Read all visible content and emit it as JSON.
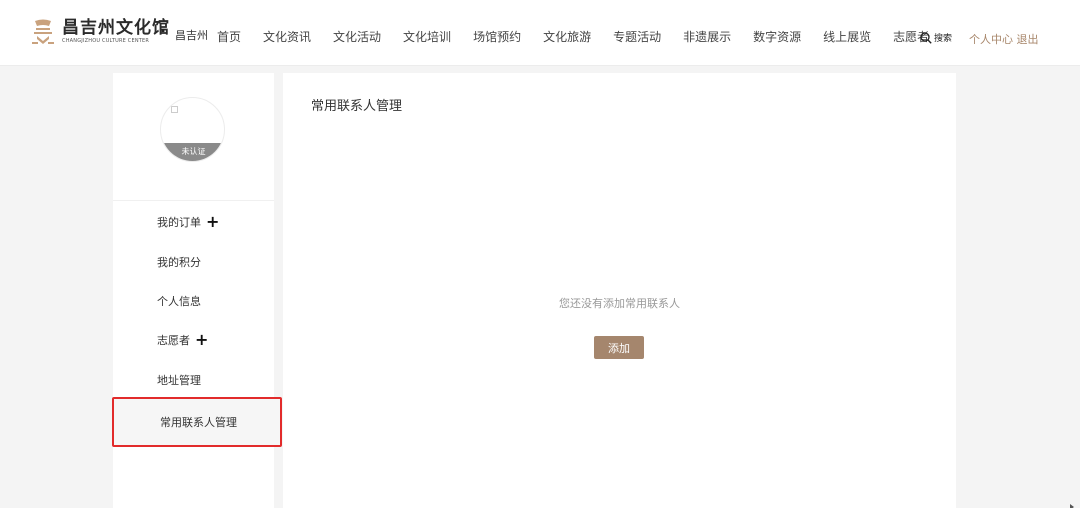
{
  "header": {
    "logo_cn": "昌吉州文化馆",
    "logo_en": "CHANGJIZHOU CULTURE CENTER",
    "logo_dot": ".",
    "city": "昌吉州",
    "nav": [
      "首页",
      "文化资讯",
      "文化活动",
      "文化培训",
      "场馆预约",
      "文化旅游",
      "专题活动",
      "非遗展示",
      "数字资源",
      "线上展览",
      "志愿者"
    ],
    "search_label": "搜索",
    "user_center": "个人中心",
    "logout": "退出",
    "accent": "#a8876b"
  },
  "sidebar": {
    "avatar_badge": "未认证",
    "items": [
      {
        "label": "我的订单",
        "expand": "+"
      },
      {
        "label": "我的积分"
      },
      {
        "label": "个人信息"
      },
      {
        "label": "志愿者",
        "expand": "+"
      },
      {
        "label": "地址管理"
      }
    ],
    "active_item": "常用联系人管理",
    "highlight_color": "#e22b2b"
  },
  "main": {
    "title": "常用联系人管理",
    "empty_message": "您还没有添加常用联系人",
    "add_button": "添加",
    "button_color": "#a5866d"
  }
}
